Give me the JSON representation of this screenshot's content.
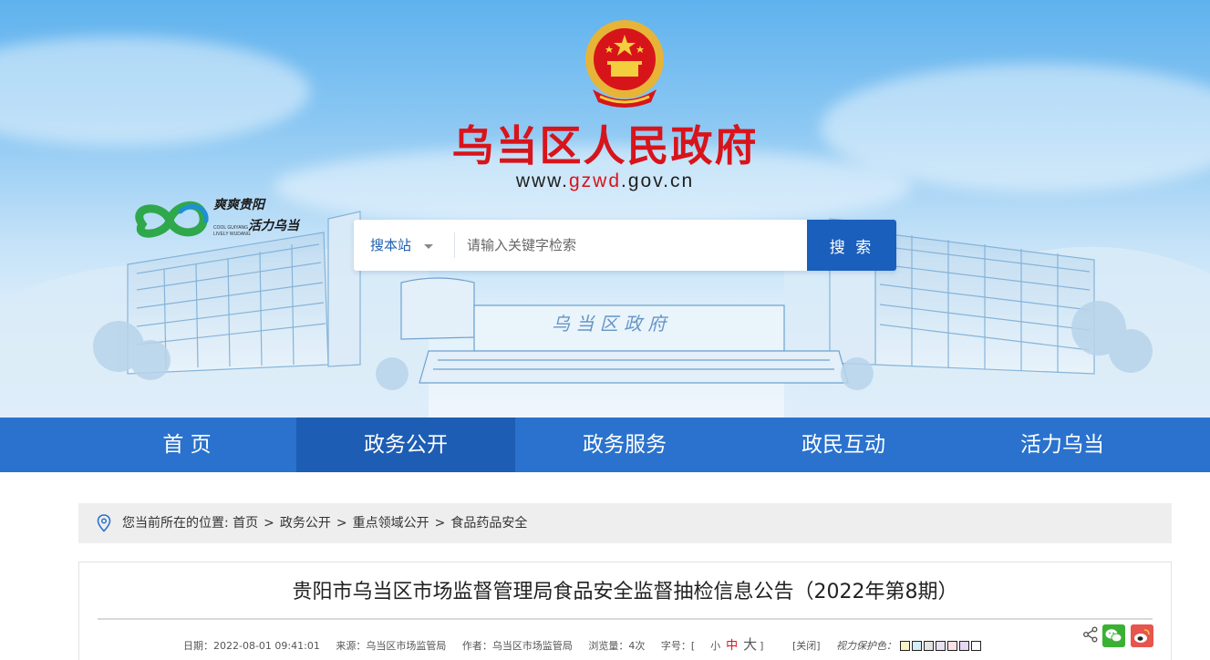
{
  "header": {
    "site_title": "乌当区人民政府",
    "site_url_prefix": "www.",
    "site_url_highlight": "gzwd",
    "site_url_suffix": ".gov.cn",
    "slogan_cn_line1": "爽爽贵阳",
    "slogan_cn_line2": "活力乌当",
    "slogan_en_line1": "COOL GUIYANG",
    "slogan_en_line2": "LIVELY WUDANG",
    "emblem_icon": "national-emblem-icon"
  },
  "search": {
    "scope_label": "搜本站",
    "placeholder": "请输入关键字检索",
    "button_label": "搜 索"
  },
  "nav": {
    "items": [
      {
        "label": "首  页"
      },
      {
        "label": "政务公开"
      },
      {
        "label": "政务服务"
      },
      {
        "label": "政民互动"
      },
      {
        "label": "活力乌当"
      }
    ],
    "active_index": 1
  },
  "breadcrumb": {
    "prefix": "您当前所在的位置:",
    "items": [
      "首页",
      "政务公开",
      "重点领域公开",
      "食品药品安全"
    ],
    "separator": ">"
  },
  "article": {
    "title": "贵阳市乌当区市场监督管理局食品安全监督抽检信息公告（2022年第8期）",
    "date": "日期：2022-08-01 09:41:01",
    "source": "来源：乌当区市场监管局",
    "author": "作者：乌当区市场监管局",
    "views": "浏览量：4次",
    "font_size_label": "字号：[",
    "font_small": "小",
    "font_medium": "中",
    "font_large": "大",
    "font_close_bracket": "]",
    "close_label": "[关闭]",
    "eye_care_label": "视力保护色：",
    "eye_care_colors": [
      "#fbf3c4",
      "#d3ecf8",
      "#e3e3e3",
      "#e9e1f1",
      "#fbe2e9",
      "#e6d8f5",
      "#ffffff"
    ]
  },
  "colors": {
    "brand_red": "#d8141b",
    "nav_blue": "#2a72cd",
    "nav_active": "#1e5db4",
    "search_button": "#1b5fbd"
  }
}
